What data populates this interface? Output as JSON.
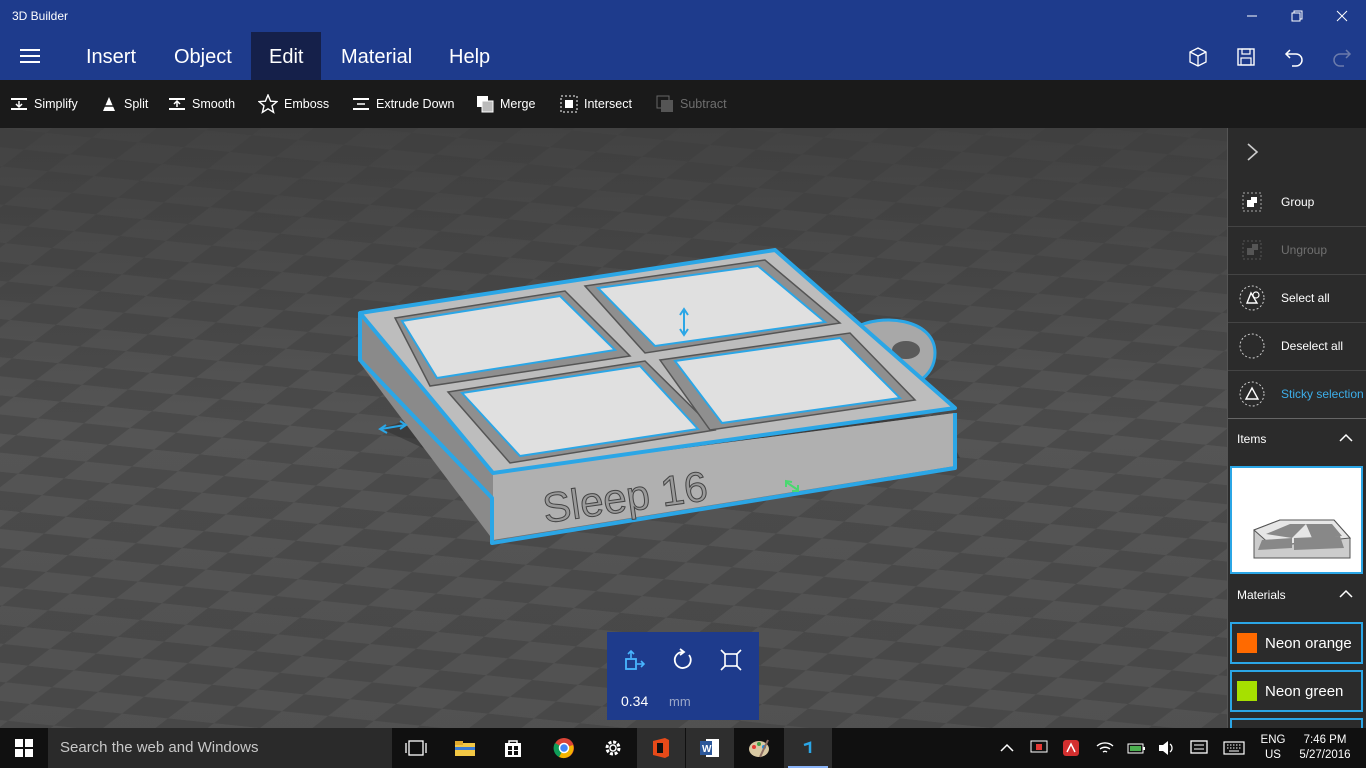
{
  "window": {
    "title": "3D Builder"
  },
  "menu": {
    "tabs": [
      {
        "label": "Insert"
      },
      {
        "label": "Object"
      },
      {
        "label": "Edit",
        "active": true
      },
      {
        "label": "Material"
      },
      {
        "label": "Help"
      }
    ]
  },
  "toolbar": {
    "simplify": "Simplify",
    "split": "Split",
    "smooth": "Smooth",
    "emboss": "Emboss",
    "extrude_down": "Extrude Down",
    "merge": "Merge",
    "intersect": "Intersect",
    "subtract": "Subtract"
  },
  "viewport": {
    "model_text": "Sleep 16"
  },
  "transform_panel": {
    "value": "0.34",
    "unit": "mm"
  },
  "right_panel": {
    "group": "Group",
    "ungroup": "Ungroup",
    "select_all": "Select all",
    "deselect_all": "Deselect all",
    "sticky_selection": "Sticky selection",
    "items_header": "Items",
    "materials_header": "Materials",
    "materials": [
      {
        "name": "Neon orange",
        "color": "#ff6a00"
      },
      {
        "name": "Neon green",
        "color": "#a6e000"
      }
    ]
  },
  "taskbar": {
    "search_placeholder": "Search the web and Windows",
    "language": "ENG",
    "region": "US",
    "time": "7:46 PM",
    "date": "5/27/2016"
  },
  "colors": {
    "accent_blue": "#1e3b8c",
    "selection_cyan": "#2ba6e6"
  }
}
